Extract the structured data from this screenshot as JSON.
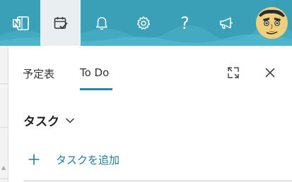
{
  "topbar": {
    "background_color": "#3aa0b8",
    "icons": [
      {
        "name": "onenote-app-icon"
      },
      {
        "name": "calendar-check-icon",
        "active": true
      },
      {
        "name": "bell-icon"
      },
      {
        "name": "gear-icon"
      },
      {
        "name": "help-icon",
        "glyph": "?"
      },
      {
        "name": "megaphone-icon"
      }
    ],
    "avatar": {
      "name": "avatar",
      "background_color": "#f0cf7c"
    }
  },
  "panel": {
    "tabs": [
      {
        "label": "予定表",
        "active": false
      },
      {
        "label": "To Do",
        "active": true
      }
    ],
    "accent_color": "#1f8aa0",
    "expand_icon": "expand-icon",
    "close_icon": "close-icon",
    "section": {
      "title": "タスク",
      "chevron": "chevron-down-icon"
    },
    "add_task": {
      "label": "タスクを追加",
      "icon": "plus-icon"
    }
  }
}
